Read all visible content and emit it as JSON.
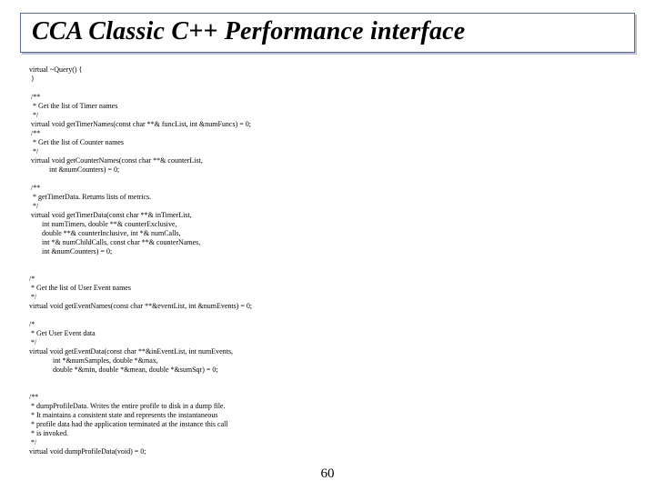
{
  "title": "CCA Classic C++ Performance interface",
  "code": "  virtual ~Query() {\n   }\n\n   /**\n    * Get the list of Timer names\n    */\n   virtual void getTimerNames(const char **& funcList, int &numFuncs) = 0;\n   /**\n    * Get the list of Counter names\n    */\n   virtual void getCounterNames(const char **& counterList,\n             int &numCounters) = 0;\n\n   /**\n    * getTimerData. Returns lists of metrics.\n    */\n   virtual void getTimerData(const char **& inTimerList,\n         int numTimers, double **& counterExclusive,\n         double **& counterInclusive, int *& numCalls,\n         int *& numChildCalls, const char **& counterNames,\n         int &numCounters) = 0;\n\n\n  /*\n   * Get the list of User Event names\n   */\n  virtual void getEventNames(const char **&eventList, int &numEvents) = 0;\n\n  /*\n   * Get User Event data\n   */\n  virtual void getEventData(const char **&inEventList, int numEvents,\n               int *&numSamples, double *&max,\n               double *&min, double *&mean, double *&sumSqr) = 0;\n\n\n  /**\n   * dumpProfileData. Writes the entire profile to disk in a dump file.\n   * It maintains a consistent state and represents the instantaneous\n   * profile data had the application terminated at the instance this call\n   * is invoked.\n   */\n  virtual void dumpProfileData(void) = 0;",
  "page_number": "60"
}
